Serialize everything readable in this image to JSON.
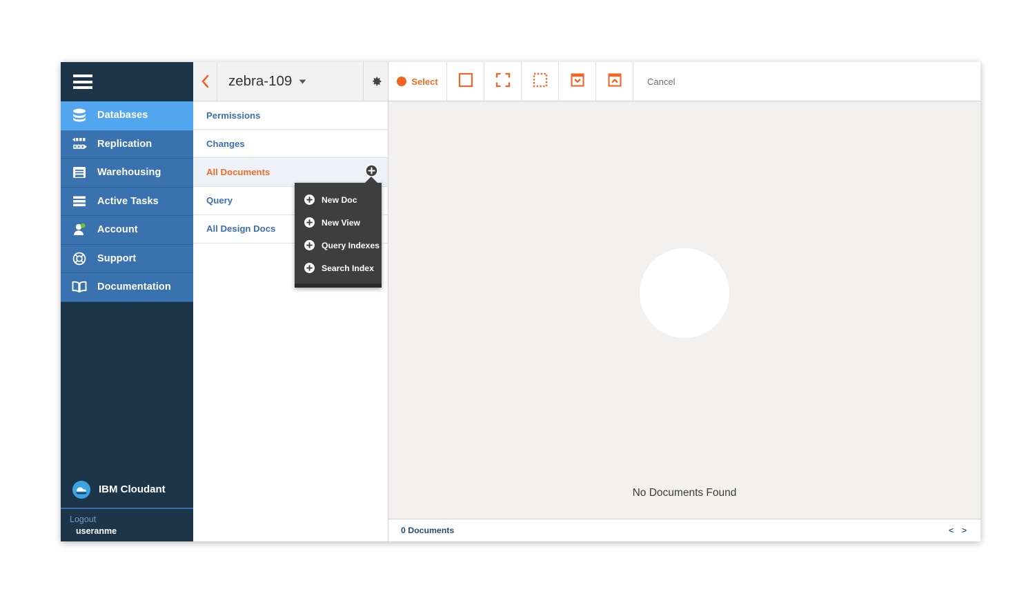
{
  "sidebar": {
    "menu_icon": "hamburger-icon",
    "items": [
      {
        "label": "Databases",
        "icon": "database-icon",
        "active": true
      },
      {
        "label": "Replication",
        "icon": "replication-icon",
        "active": false
      },
      {
        "label": "Warehousing",
        "icon": "warehousing-icon",
        "active": false
      },
      {
        "label": "Active Tasks",
        "icon": "active-tasks-icon",
        "active": false
      },
      {
        "label": "Account",
        "icon": "account-icon",
        "active": false
      },
      {
        "label": "Support",
        "icon": "support-icon",
        "active": false
      },
      {
        "label": "Documentation",
        "icon": "documentation-icon",
        "active": false
      }
    ],
    "brand": {
      "name": "IBM Cloudant",
      "logo_icon": "cloudant-cloud-icon"
    },
    "account": {
      "logout_label": "Logout",
      "username": "useranme"
    }
  },
  "doc_panel": {
    "back_icon": "back-chevron-icon",
    "database_name": "zebra-109",
    "database_caret_icon": "caret-down-icon",
    "settings_icon": "gear-icon",
    "rows": [
      {
        "label": "Permissions",
        "selected": false,
        "has_plus": false
      },
      {
        "label": "Changes",
        "selected": false,
        "has_plus": false
      },
      {
        "label": "All Documents",
        "selected": true,
        "has_plus": true
      },
      {
        "label": "Query",
        "selected": false,
        "has_plus": false
      },
      {
        "label": "All Design Docs",
        "selected": false,
        "has_plus": false
      }
    ]
  },
  "plus_menu": {
    "open": true,
    "items": [
      {
        "label": "New Doc",
        "icon": "plus-circle-icon"
      },
      {
        "label": "New View",
        "icon": "plus-circle-icon"
      },
      {
        "label": "Query Indexes",
        "icon": "plus-circle-icon"
      },
      {
        "label": "Search Index",
        "icon": "plus-circle-icon"
      }
    ]
  },
  "toolbar": {
    "select_label": "Select",
    "select_dot_icon": "filled-circle-icon",
    "buttons": [
      {
        "icon": "square-outline-icon",
        "name": "select-all-button"
      },
      {
        "icon": "expand-corners-icon",
        "name": "expand-button"
      },
      {
        "icon": "dashed-square-icon",
        "name": "select-none-button"
      },
      {
        "icon": "box-chevron-down-icon",
        "name": "collapse-all-button"
      },
      {
        "icon": "box-chevron-up-icon",
        "name": "expand-all-button"
      }
    ],
    "cancel_label": "Cancel"
  },
  "content": {
    "empty_state_label": "No Documents Found",
    "spinner_icon": "loading-circle-icon"
  },
  "statusbar": {
    "doc_count_label": "0 Documents",
    "prev_label": "<",
    "next_label": ">"
  },
  "colors": {
    "sidebar_dark": "#1d3549",
    "nav_blue": "#3a72b0",
    "nav_active_blue": "#52a6ef",
    "accent_orange": "#ec6c23",
    "link_blue": "#3a6fb8",
    "menu_dark": "#3e3e3e",
    "content_bg": "#f2f1ef"
  }
}
